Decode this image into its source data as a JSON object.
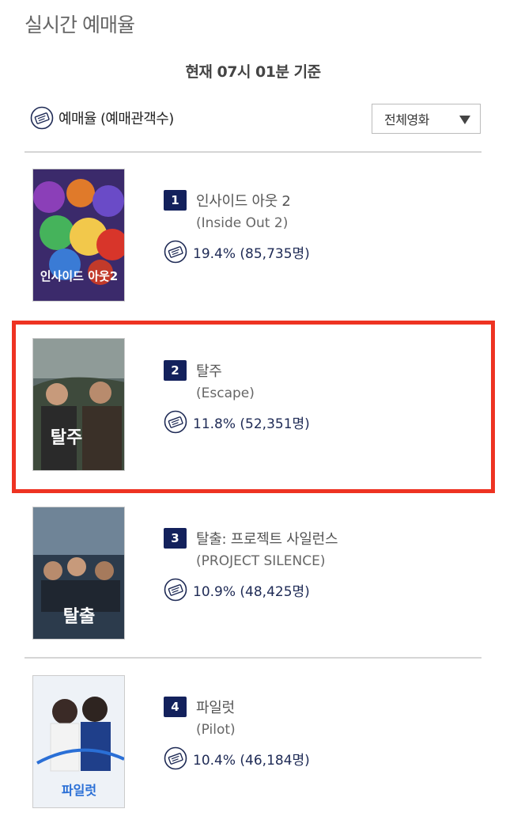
{
  "header": {
    "title": "실시간 예매율",
    "timestamp": "현재  07시 01분   기준"
  },
  "filter": {
    "label": "예매율 (예매관객수)",
    "select_value": "전체영화",
    "icon": "ticket-icon"
  },
  "colors": {
    "badge": "#13215c",
    "highlight": "#ee3322",
    "divider": "#d5d5d5"
  },
  "movies": [
    {
      "rank": "1",
      "title": "인사이드 아웃 2",
      "subtitle": "(Inside Out 2)",
      "rate": "19.4% (85,735명)",
      "poster_text": "인사이드 아웃2"
    },
    {
      "rank": "2",
      "title": "탈주",
      "subtitle": "(Escape)",
      "rate": "11.8% (52,351명)",
      "poster_text": "탈주"
    },
    {
      "rank": "3",
      "title": "탈출: 프로젝트 사일런스",
      "subtitle": "(PROJECT SILENCE)",
      "rate": "10.9% (48,425명)",
      "poster_text": "탈출"
    },
    {
      "rank": "4",
      "title": "파일럿",
      "subtitle": "(Pilot)",
      "rate": "10.4% (46,184명)",
      "poster_text": "파일럿"
    }
  ]
}
